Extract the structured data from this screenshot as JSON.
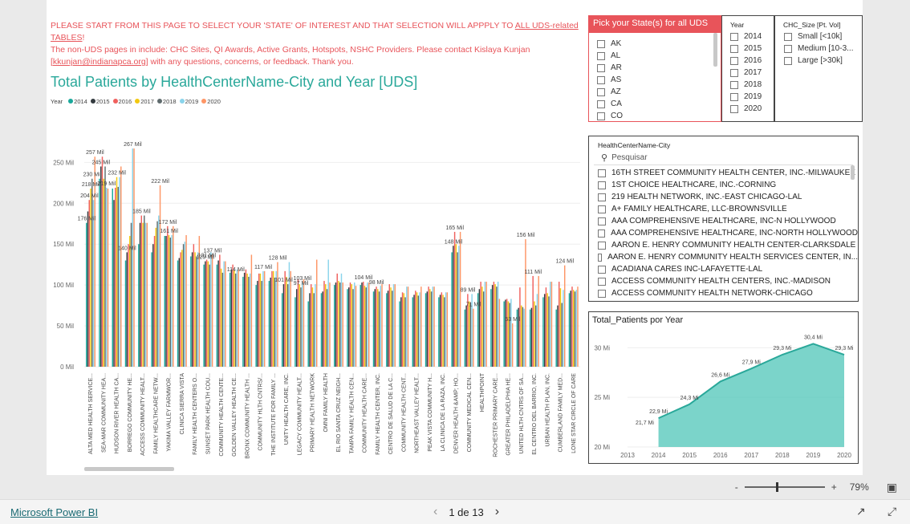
{
  "notice": {
    "line1": "PLEASE START FROM THIS PAGE TO SELECT YOUR 'STATE' OF INTEREST AND THAT SELECTION WILL APPPLY TO ",
    "line1_link": "ALL UDS-related TABLES",
    "line1_end": "!",
    "line2": "The non-UDS pages in include: CHC Sites, QI Awards, Active Grants, Hotspots, NSHC Providers. Please contact Kislaya Kunjan",
    "email": "kkunjan@indianapca.org",
    "line3": " with any questions, concerns, or feedback. Thank you."
  },
  "bar_title": "Total Patients by HealthCenterName-City and Year [UDS]",
  "legend": {
    "label": "Year",
    "items": [
      {
        "name": "2014",
        "color": "#1aa89b"
      },
      {
        "name": "2015",
        "color": "#333a3f"
      },
      {
        "name": "2016",
        "color": "#f0605e"
      },
      {
        "name": "2017",
        "color": "#f2c80f"
      },
      {
        "name": "2018",
        "color": "#5f6b6d"
      },
      {
        "name": "2019",
        "color": "#8ad4eb"
      },
      {
        "name": "2020",
        "color": "#fe9666"
      }
    ]
  },
  "chart_data": [
    {
      "type": "bar",
      "title": "Total Patients by HealthCenterName-City and Year [UDS]",
      "ylabel": "",
      "ylim": [
        0,
        270
      ],
      "yticks": [
        "0 Mil",
        "50 Mil",
        "100 Mil",
        "150 Mil",
        "200 Mil",
        "250 Mil"
      ],
      "unit": "Mil",
      "categories": [
        "ALTA MED HEALTH SERVICE...",
        "SEA-MAR COMMUNITY HEA...",
        "HUDSON RIVER HEALTH CA...",
        "BORREGO COMMUNITY HE...",
        "ACCESS COMMUNITY HEALT...",
        "FAMILY HEALTHCARE NETW...",
        "YAKIMA VALLEY FARMWOR...",
        "CLINICA SIERRA VISTA",
        "FAMILY HEALTH CENTERS O...",
        "SUNSET PARK HEALTH COU...",
        "COMMUNITY HEALTH CENTE...",
        "GOLDEN VALLEY HEALTH CE...",
        "BRONX COMMUNITY HEALTH ...",
        "COMMUNITY HLTH CNTRS/...",
        "THE INSTITUTE FOR FAMILY ...",
        "UNITY HEALTH CARE, INC.",
        "LEGACY COMMUNITY HEALT...",
        "PRIMARY HEALTH NETWORK",
        "OMNI FAMILY HEALTH",
        "EL RIO SANTA CRUZ NEIGH...",
        "TAMPA FAMILY HEALTH CEN...",
        "COMMUNITY HEALTH CARE...",
        "FAMILY HEALTH CENTER, INC.",
        "CENTRO DE SALUD DE LA C...",
        "COMMUNITY HEALTH CENT...",
        "NORTHEAST VALLEY HEALT...",
        "PEAK VISTA COMMUNITY H...",
        "LA CLINICA DE LA RAZA, INC.",
        "DENVER HEALTH &AMP; HO...",
        "COMMUNITY MEDICAL CEN...",
        "HEALTHPOINT",
        "ROCHESTER PRIMARY CARE...",
        "GREATER PHILADELPHIA HE...",
        "UNITED HLTH CNTRS OF SA...",
        "EL CENTRO DEL BARRIO, INC.",
        "URBAN HEALTH PLAN, INC.",
        "CUMBERLAND FAMILY MED...",
        "LONE STAR CIRCLE OF CARE"
      ],
      "series": [
        {
          "name": "2014",
          "values": [
            176,
            230,
            218,
            130,
            150,
            140,
            160,
            130,
            135,
            125,
            125,
            115,
            110,
            100,
            105,
            90,
            85,
            80,
            90,
            100,
            95,
            100,
            92,
            90,
            80,
            85,
            90,
            85,
            140,
            70,
            90,
            95,
            80,
            70,
            70,
            85,
            70,
            90
          ]
        },
        {
          "name": "2015",
          "values": [
            190,
            245,
            204,
            140,
            176,
            150,
            160,
            133,
            140,
            129,
            130,
            119,
            115,
            105,
            109,
            101,
            95,
            90,
            92,
            103,
            97,
            103,
            95,
            93,
            85,
            88,
            92,
            88,
            148,
            75,
            95,
            100,
            82,
            72,
            72,
            89,
            75,
            93
          ]
        },
        {
          "name": "2016",
          "values": [
            204,
            257,
            219,
            150,
            185,
            160,
            172,
            140,
            150,
            131,
            137,
            125,
            119,
            114,
            117,
            117,
            107,
            101,
            105,
            114,
            103,
            104,
            98,
            101,
            91,
            93,
            98,
            91,
            165,
            89,
            104,
            104,
            83,
            97,
            111,
            97,
            104,
            98
          ]
        },
        {
          "name": "2017",
          "values": [
            218,
            230,
            232,
            160,
            176,
            170,
            161,
            143,
            140,
            129,
            120,
            118,
            114,
            114,
            117,
            110,
            101,
            97,
            101,
            105,
            101,
            99,
            95,
            97,
            90,
            91,
            95,
            88,
            150,
            80,
            98,
            101,
            80,
            75,
            80,
            90,
            96,
            94
          ]
        },
        {
          "name": "2018",
          "values": [
            230,
            245,
            220,
            176,
            185,
            178,
            158,
            150,
            135,
            125,
            115,
            114,
            110,
            105,
            109,
            101,
            97,
            90,
            95,
            103,
            95,
            97,
            92,
            93,
            85,
            87,
            92,
            85,
            140,
            78,
            92,
            98,
            78,
            73,
            75,
            86,
            78,
            92
          ]
        },
        {
          "name": "2019",
          "values": [
            204,
            219,
            232,
            267,
            176,
            185,
            161,
            153,
            140,
            140,
            129,
            119,
            114,
            117,
            117,
            128,
            103,
            101,
            131,
            114,
            103,
            103,
            99,
            101,
            98,
            91,
            98,
            91,
            148,
            89,
            104,
            104,
            83,
            71,
            89,
            104,
            94,
            94
          ]
        },
        {
          "name": "2020",
          "values": [
            257,
            218,
            245,
            267,
            176,
            222,
            172,
            161,
            160,
            137,
            129,
            119,
            137,
            117,
            128,
            117,
            107,
            131,
            103,
            103,
            99,
            103,
            101,
            101,
            98,
            98,
            98,
            91,
            165,
            71,
            104,
            83,
            53,
            156,
            111,
            104,
            124,
            98
          ]
        }
      ]
    },
    {
      "type": "area",
      "title": "Total_Patients por Year",
      "x": [
        "2013",
        "2014",
        "2015",
        "2016",
        "2017",
        "2018",
        "2019",
        "2020"
      ],
      "values": [
        21.7,
        22.9,
        24.3,
        26.6,
        27.9,
        29.3,
        30.4,
        29.3
      ],
      "labels": [
        "21,7 Mi",
        "22,9 Mi",
        "24,3 Mi",
        "26,6 Mi",
        "27,9 Mi",
        "29,3 Mi",
        "30,4 Mi",
        "29,3 Mi"
      ],
      "ylim": [
        20,
        31
      ],
      "yticks": [
        "20 Mi",
        "25 Mi",
        "30 Mi"
      ],
      "color": "#4fc6b8"
    }
  ],
  "bar_data_labels": [
    {
      "text": "257 Mil"
    },
    {
      "text": "267 Mil"
    },
    {
      "text": "245 Mil"
    },
    {
      "text": "232 Mil"
    },
    {
      "text": "230 Mil"
    },
    {
      "text": "218 Mil"
    },
    {
      "text": "219 Mil"
    },
    {
      "text": "222 Mil"
    },
    {
      "text": "214 Mil"
    },
    {
      "text": "204 Mil"
    },
    {
      "text": "185 Mil"
    },
    {
      "text": "176 Mil"
    },
    {
      "text": "172 Mil"
    },
    {
      "text": "161 Mil"
    },
    {
      "text": "165 Mil"
    },
    {
      "text": "156 Mil"
    },
    {
      "text": "148 Mil"
    },
    {
      "text": "140 Mil"
    },
    {
      "text": "137 Mil"
    },
    {
      "text": "131 Mil"
    },
    {
      "text": "129 Mil"
    },
    {
      "text": "128 Mil"
    },
    {
      "text": "124 Mil"
    },
    {
      "text": "117 Mil"
    },
    {
      "text": "114 Mil"
    },
    {
      "text": "111 Mil"
    },
    {
      "text": "104 Mil"
    },
    {
      "text": "103 Mil"
    },
    {
      "text": "101 Mil"
    },
    {
      "text": "98 Mil"
    },
    {
      "text": "97 Mil"
    },
    {
      "text": "89 Mil"
    },
    {
      "text": "71 Mil"
    },
    {
      "text": "53 Mil"
    }
  ],
  "state_slicer": {
    "title": "Pick your State(s) for all UDS",
    "options": [
      "AK",
      "AL",
      "AR",
      "AS",
      "AZ",
      "CA",
      "CO"
    ]
  },
  "year_slicer": {
    "title": "Year",
    "options": [
      "2014",
      "2015",
      "2016",
      "2017",
      "2018",
      "2019",
      "2020"
    ]
  },
  "size_slicer": {
    "title": "CHC_Size [Pt. Vol]",
    "options": [
      "Small [<10k]",
      "Medium [10-3...",
      "Large [>30k]"
    ]
  },
  "hc_slicer": {
    "title": "HealthCenterName-City",
    "search_placeholder": "Pesquisar",
    "options": [
      "16TH STREET COMMUNITY HEALTH CENTER, INC.-MILWAUKEE",
      "1ST CHOICE HEALTHCARE, INC.-CORNING",
      "219 HEALTH NETWORK, INC.-EAST CHICAGO-LAL",
      "A+ FAMILY HEALTHCARE, LLC-BROWNSVILLE",
      "AAA COMPREHENSIVE HEALTHCARE, INC-N HOLLYWOOD",
      "AAA COMPREHENSIVE HEALTHCARE, INC-NORTH HOLLYWOOD",
      "AARON E. HENRY COMMUNITY HEALTH CENTER-CLARKSDALE",
      "AARON E. HENRY COMMUNITY HEALTH SERVICES CENTER, IN...",
      "ACADIANA CARES INC-LAFAYETTE-LAL",
      "ACCESS COMMUNITY HEALTH CENTERS, INC.-MADISON",
      "ACCESS COMMUNITY HEALTH NETWORK-CHICAGO"
    ]
  },
  "footer": {
    "brand": "Microsoft Power BI",
    "page_text": "1 de 13",
    "zoom_text": "79%",
    "zoom_level": 0.79,
    "minus": "-",
    "plus": "+"
  }
}
